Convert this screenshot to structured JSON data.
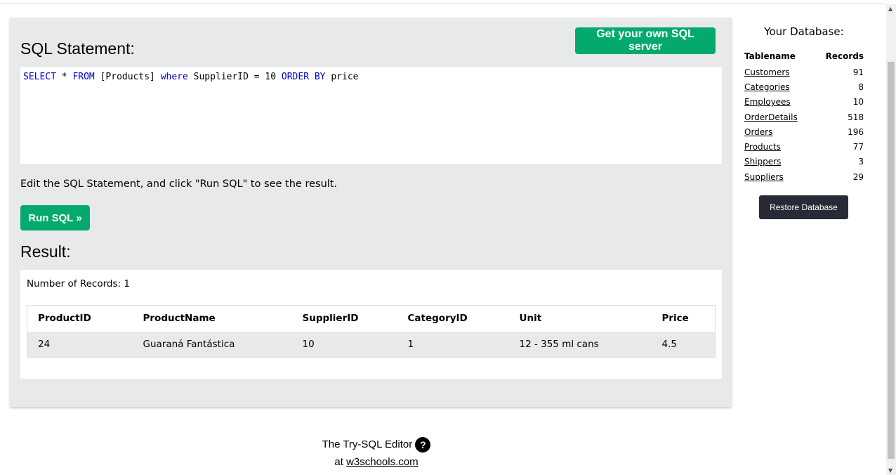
{
  "sql": {
    "heading": "SQL Statement:",
    "get_server": "Get your own SQL server",
    "tokens": [
      {
        "t": "SELECT",
        "k": true
      },
      {
        "t": " * ",
        "k": false
      },
      {
        "t": "FROM",
        "k": true
      },
      {
        "t": " [Products] ",
        "k": false
      },
      {
        "t": "where",
        "k": true
      },
      {
        "t": " SupplierID = 10 ",
        "k": false
      },
      {
        "t": "ORDER BY",
        "k": true
      },
      {
        "t": " price",
        "k": false
      }
    ],
    "hint": "Edit the SQL Statement, and click \"Run SQL\" to see the result.",
    "run": "Run SQL »"
  },
  "result": {
    "heading": "Result:",
    "count": "Number of Records: 1",
    "columns": [
      "ProductID",
      "ProductName",
      "SupplierID",
      "CategoryID",
      "Unit",
      "Price"
    ],
    "rows": [
      [
        "24",
        "Guaraná Fantástica",
        "10",
        "1",
        "12 - 355 ml cans",
        "4.5"
      ]
    ]
  },
  "database": {
    "title": "Your Database:",
    "col_name": "Tablename",
    "col_records": "Records",
    "tables": [
      {
        "name": "Customers",
        "records": "91"
      },
      {
        "name": "Categories",
        "records": "8"
      },
      {
        "name": "Employees",
        "records": "10"
      },
      {
        "name": "OrderDetails",
        "records": "518"
      },
      {
        "name": "Orders",
        "records": "196"
      },
      {
        "name": "Products",
        "records": "77"
      },
      {
        "name": "Shippers",
        "records": "3"
      },
      {
        "name": "Suppliers",
        "records": "29"
      }
    ],
    "restore": "Restore Database"
  },
  "footer": {
    "line1": "The Try-SQL Editor",
    "help": "?",
    "at": "at",
    "link": "w3schools.com"
  }
}
